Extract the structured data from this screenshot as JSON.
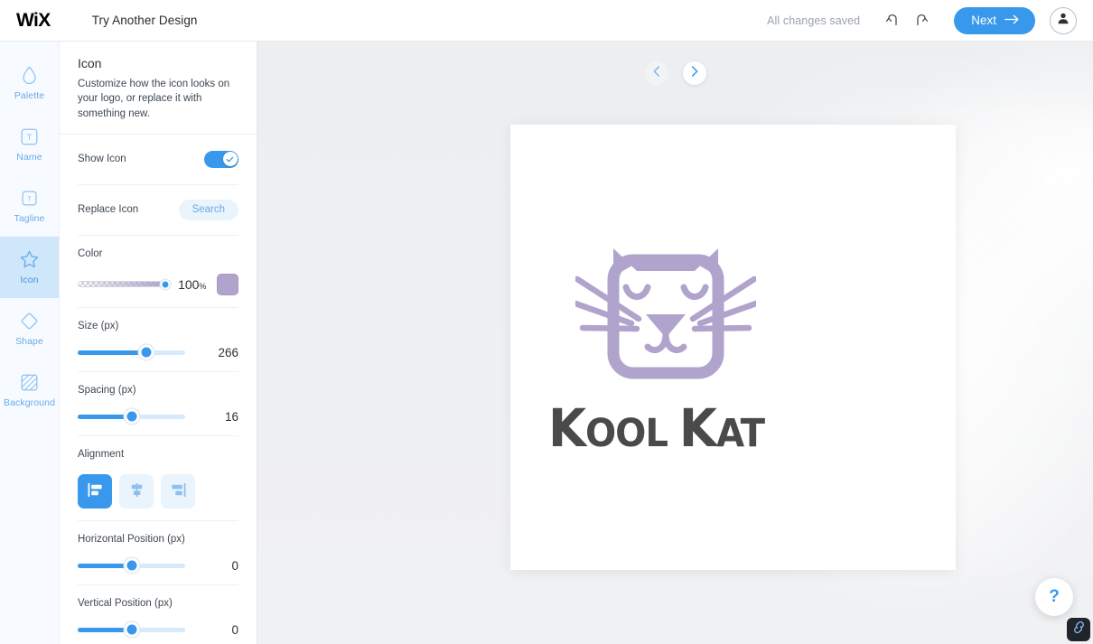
{
  "topbar": {
    "brand": "WiX",
    "try_another": "Try Another Design",
    "saved_status": "All changes saved",
    "undo_icon": "undo-icon",
    "redo_icon": "redo-icon",
    "next_label": "Next",
    "next_arrow": "→",
    "avatar_icon": "user-avatar-icon"
  },
  "rail": {
    "items": [
      {
        "label": "Palette",
        "icon": "droplet-icon",
        "active": false
      },
      {
        "label": "Name",
        "icon": "text-box-icon",
        "active": false
      },
      {
        "label": "Tagline",
        "icon": "small-text-box-icon",
        "active": false
      },
      {
        "label": "Icon",
        "icon": "star-icon",
        "active": true
      },
      {
        "label": "Shape",
        "icon": "diamond-icon",
        "active": false
      },
      {
        "label": "Background",
        "icon": "hatched-square-icon",
        "active": false
      }
    ]
  },
  "panel": {
    "title": "Icon",
    "description": "Customize how the icon looks on your logo, or replace it with something new.",
    "show_icon": {
      "label": "Show Icon",
      "value": true,
      "check_icon": "check-icon"
    },
    "replace_icon": {
      "label": "Replace Icon",
      "button_label": "Search"
    },
    "color": {
      "label": "Color",
      "opacity_value": "100",
      "opacity_unit": "%",
      "swatch_hex": "#b0a4cc"
    },
    "size": {
      "label": "Size (px)",
      "value": "266",
      "fill_percent": 64
    },
    "spacing": {
      "label": "Spacing (px)",
      "value": "16",
      "fill_percent": 50
    },
    "alignment": {
      "label": "Alignment",
      "options": [
        {
          "name": "align-left",
          "icon": "align-left-icon",
          "active": true
        },
        {
          "name": "align-center",
          "icon": "align-center-icon",
          "active": false
        },
        {
          "name": "align-right",
          "icon": "align-right-icon",
          "active": false
        }
      ]
    },
    "horizontal_position": {
      "label": "Horizontal Position (px)",
      "value": "0",
      "fill_percent": 50
    },
    "vertical_position": {
      "label": "Vertical Position (px)",
      "value": "0",
      "fill_percent": 50
    }
  },
  "canvas": {
    "prev_icon": "chevron-left-icon",
    "next_icon": "chevron-right-icon",
    "logo": {
      "icon_name": "cat-face-icon",
      "icon_color": "#b0a4cc",
      "text_line": "Kool Kat",
      "text_color": "#4a4a4a"
    },
    "help_label": "?",
    "link_badge_icon": "link-chain-icon"
  }
}
